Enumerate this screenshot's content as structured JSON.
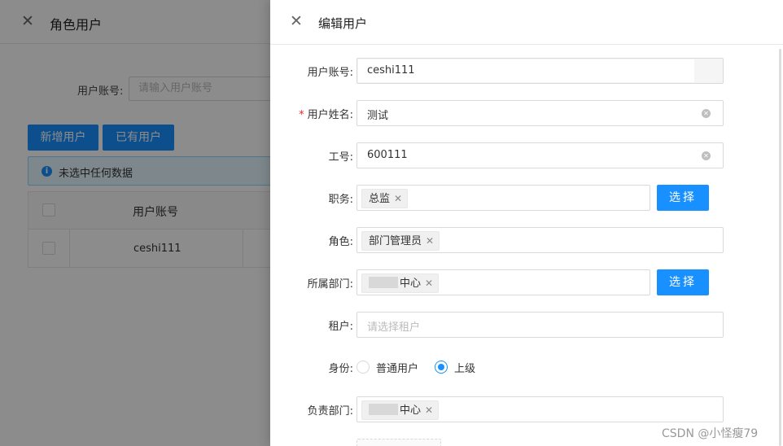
{
  "background": {
    "title": "角色用户",
    "search": {
      "label": "用户账号:",
      "placeholder": "请输入用户账号"
    },
    "buttons": {
      "add": "新增用户",
      "existing": "已有用户"
    },
    "alert": "未选中任何数据",
    "table": {
      "header": "用户账号",
      "rows": [
        {
          "account": "ceshi111"
        }
      ]
    }
  },
  "drawer": {
    "title": "编辑用户",
    "form": {
      "account": {
        "label": "用户账号:",
        "value": "ceshi111"
      },
      "name": {
        "label": "用户姓名:",
        "value": "测试",
        "required": true
      },
      "workno": {
        "label": "工号:",
        "value": "600111"
      },
      "post": {
        "label": "职务:",
        "tag": "总监",
        "button": "选择"
      },
      "role": {
        "label": "角色:",
        "tag": "部门管理员"
      },
      "dept": {
        "label": "所属部门:",
        "tag_suffix": "中心",
        "button": "选择"
      },
      "tenant": {
        "label": "租户:",
        "placeholder": "请选择租户"
      },
      "identity": {
        "label": "身份:",
        "options": [
          "普通用户",
          "上级"
        ],
        "selected": "上级"
      },
      "dept_owner": {
        "label": "负责部门:",
        "tag_suffix": "中心"
      }
    }
  },
  "watermark": "CSDN @小怪瘦79",
  "colors": {
    "primary": "#1890ff",
    "mask": "rgba(0,0,0,0.45)",
    "required": "#f5222d"
  }
}
